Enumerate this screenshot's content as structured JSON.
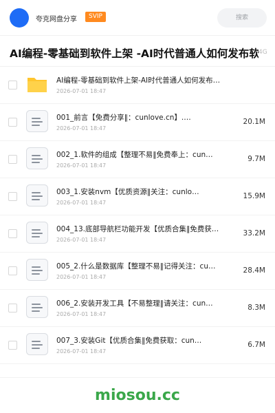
{
  "header": {
    "sharer_name": "夸克网盘分享",
    "badge": "SVIP",
    "search_label": "搜索"
  },
  "share": {
    "title": "AI编程-零基础到软件上架 -AI时代普通人如何发布软件",
    "size_hint": "4G"
  },
  "files": [
    {
      "name": "AI编程-零基础到软件上架-AI时代普通人如何发布…",
      "date": "2026-07-01 18:47",
      "size": "",
      "type": "folder-icon"
    },
    {
      "name": "001_前言【免费分享‖：cunlove.cn】.…",
      "date": "2026-07-01 18:47",
      "size": "20.1M",
      "type": "file-icon"
    },
    {
      "name": "002_1.软件的组成【整理不易‖免费奉上：cun…",
      "date": "2026-07-01 18:47",
      "size": "9.7M",
      "type": "file-icon"
    },
    {
      "name": "003_1.安装nvm【优质资源‖关注：cunlo…",
      "date": "2026-07-01 18:47",
      "size": "15.9M",
      "type": "file-icon"
    },
    {
      "name": "004_13.底部导航栏功能开发【优质合集‖免费获…",
      "date": "2026-07-01 18:47",
      "size": "33.2M",
      "type": "file-icon"
    },
    {
      "name": "005_2.什么是数据库【整理不易‖记得关注：cu…",
      "date": "2026-07-01 18:47",
      "size": "28.4M",
      "type": "file-icon"
    },
    {
      "name": "006_2.安装开发工具【不易整理‖请关注：cun…",
      "date": "2026-07-01 18:47",
      "size": "8.3M",
      "type": "file-icon"
    },
    {
      "name": "007_3.安装Git【优质合集‖免费获取：cun…",
      "date": "2026-07-01 18:47",
      "size": "6.7M",
      "type": "file-icon"
    }
  ],
  "watermark": "miosou.cc",
  "colors": {
    "avatar": "#1e6cf6",
    "svip_badge": "#ff8a1f",
    "folder": "#ffc52e",
    "watermark": "#3aa74a"
  }
}
